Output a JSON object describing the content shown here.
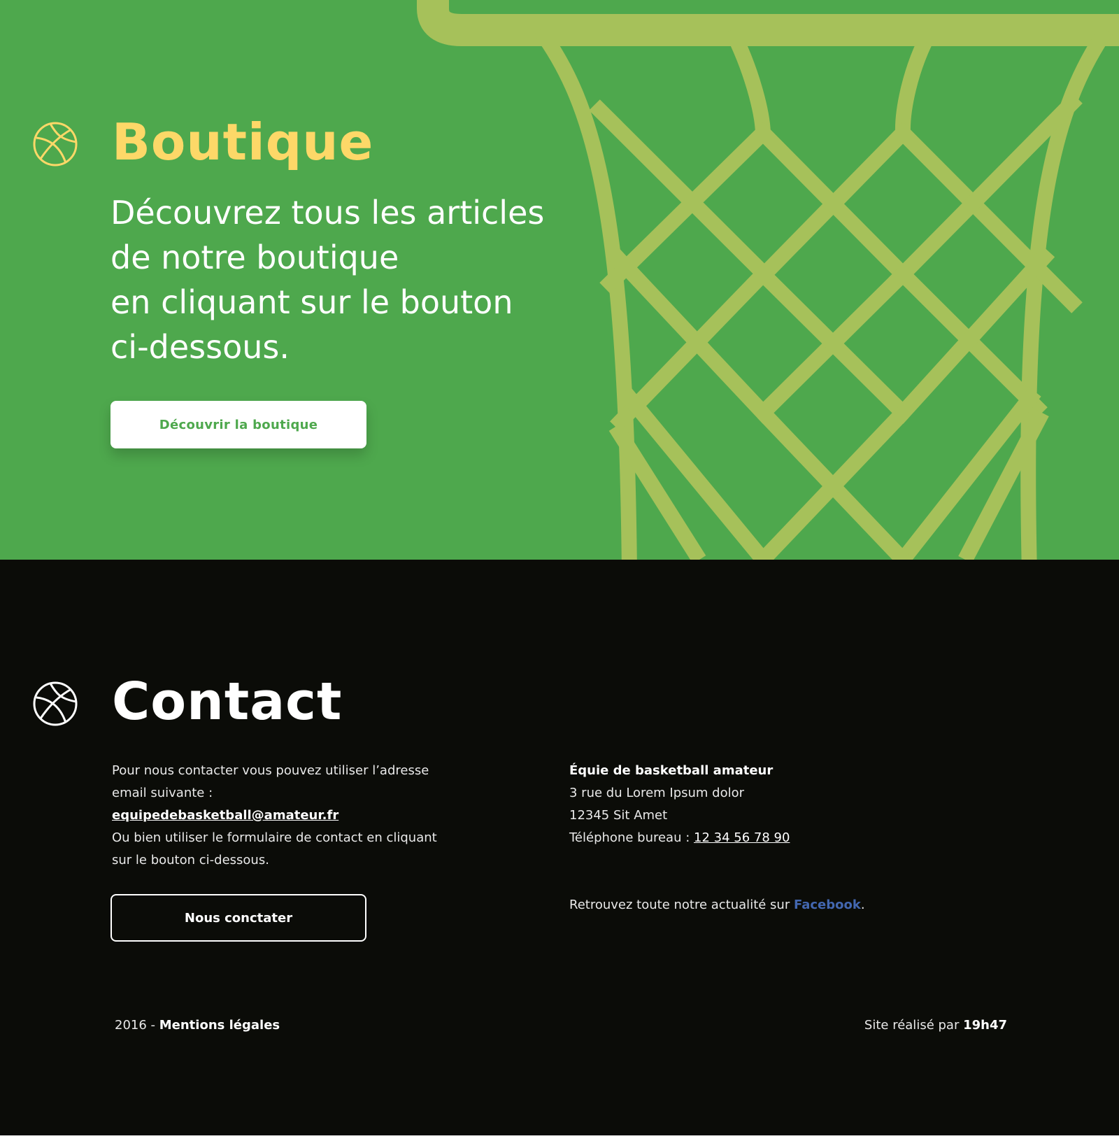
{
  "colors": {
    "green_bg": "#4ea84d",
    "hoop_lime": "#a6c15a",
    "yellow_title": "#fdd868",
    "dark_bg": "#0b0c08",
    "facebook_blue": "#4367b0"
  },
  "boutique": {
    "icon": "basketball-icon",
    "title": "Boutique",
    "description_lines": [
      "Découvrez tous les articles",
      "de notre boutique",
      "en cliquant sur le bouton",
      "ci-dessous."
    ],
    "button_label": "Découvrir la boutique"
  },
  "contact": {
    "icon": "basketball-icon",
    "title": "Contact",
    "intro_line1": "Pour nous contacter vous pouvez utiliser l’adresse",
    "intro_line2": "email suivante :",
    "email": "equipedebasketball@amateur.fr",
    "form_line1": "Ou bien utiliser le formulaire de contact en cliquant",
    "form_line2": "sur le bouton ci-dessous.",
    "button_label": "Nous conctater",
    "org_name": "Équie de basketball amateur",
    "address_line1": "3 rue du Lorem Ipsum dolor",
    "address_line2": "12345 Sit Amet",
    "phone_label": "Téléphone bureau : ",
    "phone": "12 34 56 78 90",
    "social_prefix": "Retrouvez toute notre actualité sur ",
    "social_link": "Facebook",
    "social_suffix": "."
  },
  "footer": {
    "year_prefix": "2016 - ",
    "legal_link": "Mentions légales",
    "credit_prefix": "Site réalisé par ",
    "credit_link": "19h47"
  }
}
